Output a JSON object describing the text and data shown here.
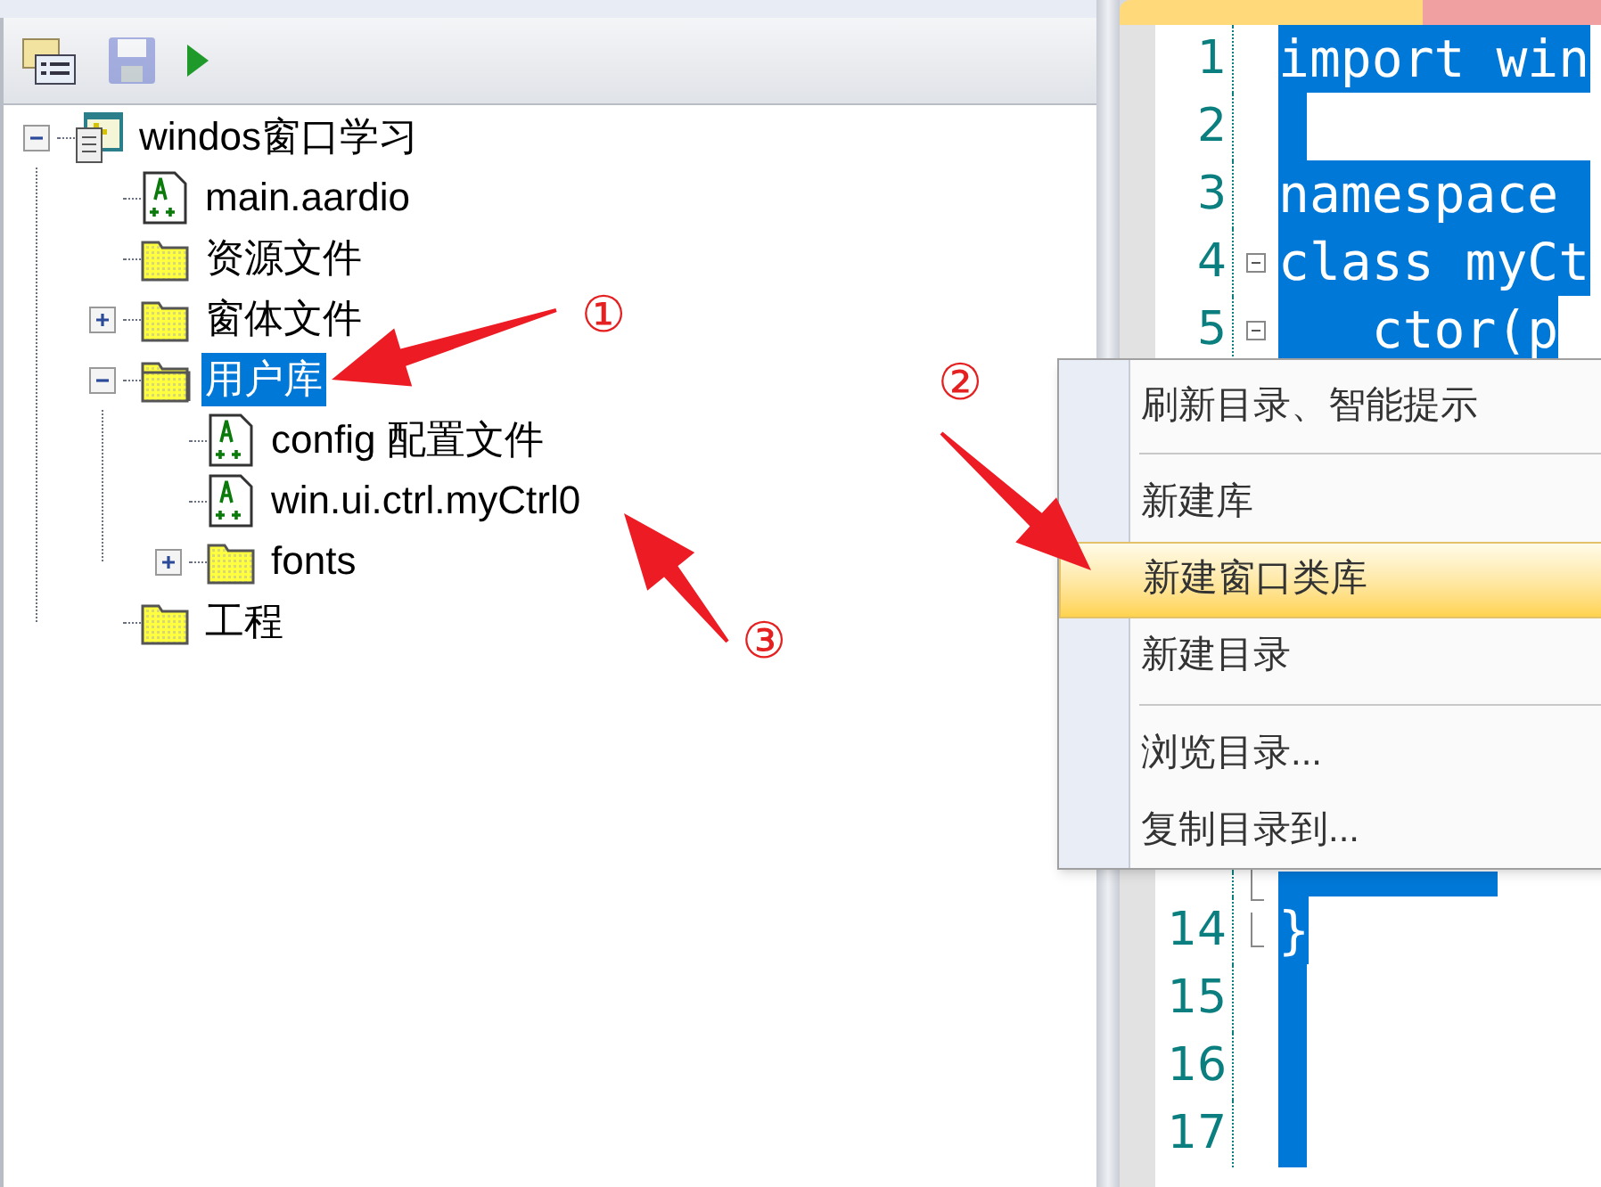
{
  "toolbar": [
    {
      "kind": "project",
      "disabled": false
    },
    {
      "kind": "save",
      "disabled": true
    },
    {
      "kind": "run",
      "disabled": false
    }
  ],
  "tree": [
    {
      "label": "windos窗口学习",
      "kind": "project",
      "expanded": true,
      "selected": false,
      "children": [
        {
          "label": "main.aardio",
          "kind": "file",
          "selected": false
        },
        {
          "label": "资源文件",
          "kind": "folder",
          "selected": false
        },
        {
          "label": "窗体文件",
          "kind": "folder",
          "expanded": false,
          "selected": false
        },
        {
          "label": "用户库",
          "kind": "folder",
          "expanded": true,
          "selected": true,
          "children": [
            {
              "label": "config 配置文件",
              "kind": "file",
              "selected": false
            },
            {
              "label": "win.ui.ctrl.myCtrl0",
              "kind": "file",
              "selected": false
            },
            {
              "label": "fonts",
              "kind": "folder",
              "expanded": false,
              "selected": false
            }
          ]
        },
        {
          "label": "工程",
          "kind": "folder",
          "selected": false
        }
      ]
    }
  ],
  "editor": {
    "selected": true,
    "top_lines": [
      {
        "number": "1",
        "code": "import win"
      },
      {
        "number": "2"
      },
      {
        "number": "3",
        "code": "namespace "
      },
      {
        "number": "4",
        "code": "class myCt",
        "fold_start": true
      },
      {
        "number": "5",
        "code": "   ctor(p",
        "fold_start": true
      }
    ],
    "bottom_lines": [
      {
        "fold_end": true
      },
      {
        "number": "14",
        "code": "}",
        "fold_end": true
      },
      {
        "number": "15"
      },
      {
        "number": "16"
      },
      {
        "number": "17"
      }
    ]
  },
  "context_menu": [
    {
      "kind": "item",
      "label": "刷新目录、智能提示",
      "selected": false
    },
    {
      "kind": "separator"
    },
    {
      "kind": "item",
      "label": "新建库",
      "selected": false
    },
    {
      "kind": "item",
      "label": "新建窗口类库",
      "selected": true
    },
    {
      "kind": "item",
      "label": "新建目录",
      "selected": false
    },
    {
      "kind": "separator"
    },
    {
      "kind": "item",
      "label": "浏览目录...",
      "selected": false
    },
    {
      "kind": "item",
      "label": "复制目录到...",
      "selected": false
    }
  ],
  "annotations": [
    {
      "label": "①"
    },
    {
      "label": "②"
    },
    {
      "label": "③"
    }
  ]
}
